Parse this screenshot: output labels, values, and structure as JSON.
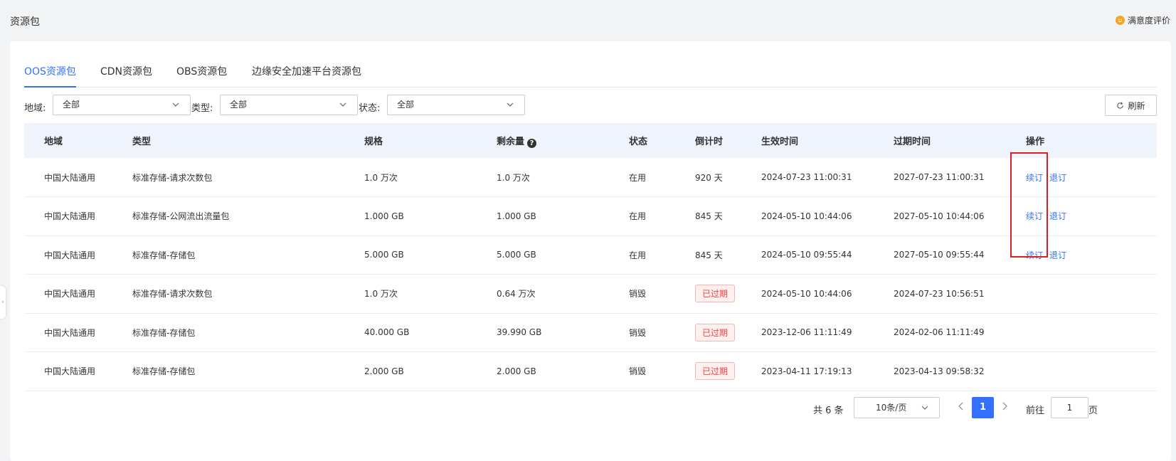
{
  "header": {
    "title": "资源包",
    "rating_label": "满意度评价"
  },
  "tabs": [
    {
      "label": "OOS资源包",
      "active": true
    },
    {
      "label": "CDN资源包",
      "active": false
    },
    {
      "label": "OBS资源包",
      "active": false
    },
    {
      "label": "边缘安全加速平台资源包",
      "active": false
    }
  ],
  "filters": {
    "region": {
      "label": "地域:",
      "value": "全部"
    },
    "type": {
      "label": "类型:",
      "value": "全部"
    },
    "status": {
      "label": "状态:",
      "value": "全部"
    }
  },
  "refresh_label": "刷新",
  "table": {
    "columns": [
      "地域",
      "类型",
      "规格",
      "剩余量",
      "状态",
      "倒计时",
      "生效时间",
      "过期时间",
      "操作"
    ],
    "rows": [
      {
        "region": "中国大陆通用",
        "type": "标准存储-请求次数包",
        "spec": "1.0 万次",
        "remaining": "1.0 万次",
        "status": "在用",
        "countdown": "920 天",
        "start": "2024-07-23 11:00:31",
        "end": "2027-07-23 11:00:31",
        "expired": false,
        "actions": [
          "续订",
          "退订"
        ]
      },
      {
        "region": "中国大陆通用",
        "type": "标准存储-公网流出流量包",
        "spec": "1.000 GB",
        "remaining": "1.000 GB",
        "status": "在用",
        "countdown": "845 天",
        "start": "2024-05-10 10:44:06",
        "end": "2027-05-10 10:44:06",
        "expired": false,
        "actions": [
          "续订",
          "退订"
        ]
      },
      {
        "region": "中国大陆通用",
        "type": "标准存储-存储包",
        "spec": "5.000 GB",
        "remaining": "5.000 GB",
        "status": "在用",
        "countdown": "845 天",
        "start": "2024-05-10 09:55:44",
        "end": "2027-05-10 09:55:44",
        "expired": false,
        "actions": [
          "续订",
          "退订"
        ]
      },
      {
        "region": "中国大陆通用",
        "type": "标准存储-请求次数包",
        "spec": "1.0 万次",
        "remaining": "0.64 万次",
        "status": "销毁",
        "countdown": "已过期",
        "start": "2024-05-10 10:44:06",
        "end": "2024-07-23 10:56:51",
        "expired": true,
        "actions": []
      },
      {
        "region": "中国大陆通用",
        "type": "标准存储-存储包",
        "spec": "40.000 GB",
        "remaining": "39.990 GB",
        "status": "销毁",
        "countdown": "已过期",
        "start": "2023-12-06 11:11:49",
        "end": "2024-02-06 11:11:49",
        "expired": true,
        "actions": []
      },
      {
        "region": "中国大陆通用",
        "type": "标准存储-存储包",
        "spec": "2.000 GB",
        "remaining": "2.000 GB",
        "status": "销毁",
        "countdown": "已过期",
        "start": "2023-04-11 17:19:13",
        "end": "2023-04-13 09:58:32",
        "expired": true,
        "actions": []
      }
    ]
  },
  "pagination": {
    "total_label": "共 6 条",
    "page_size": "10条/页",
    "current_page": "1",
    "goto_label": "前往",
    "goto_value": "1",
    "goto_unit": "页"
  },
  "colors": {
    "accent": "#3370ff",
    "expired": "#f53f3f",
    "highlight_box": "#e02020"
  }
}
